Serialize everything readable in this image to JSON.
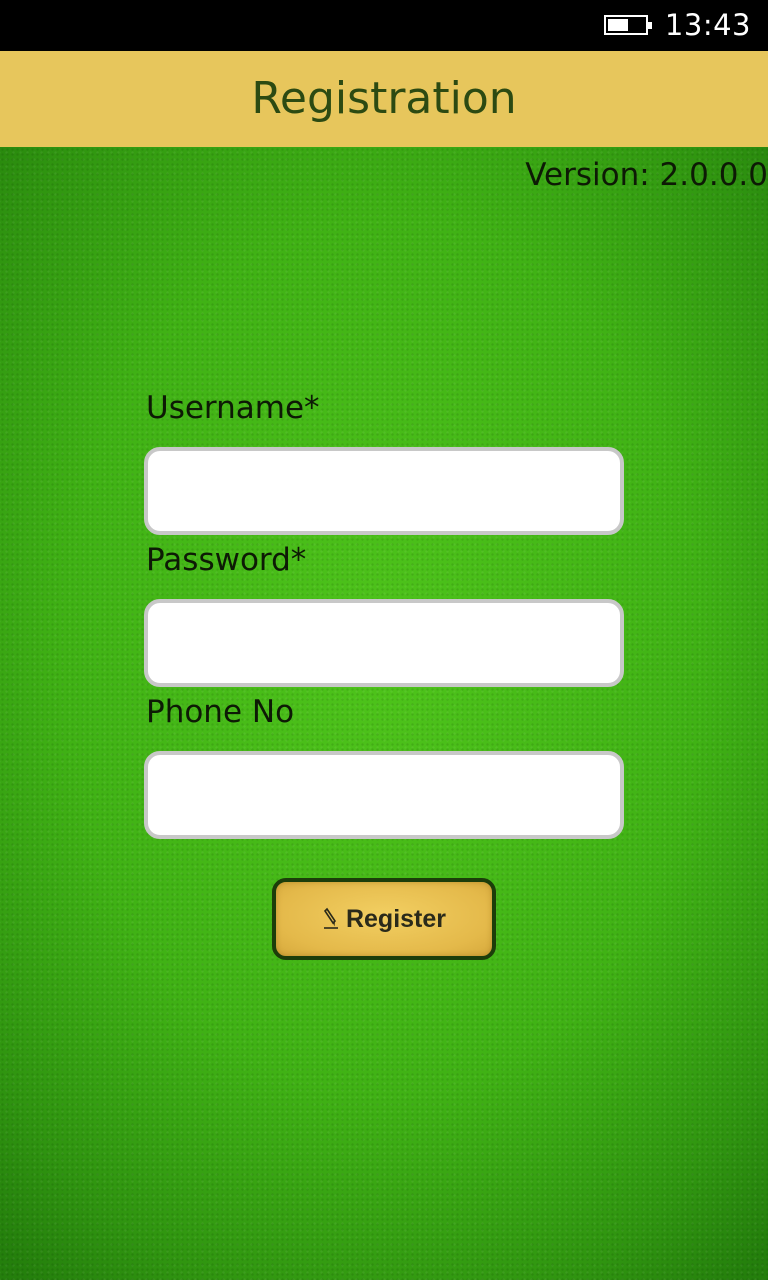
{
  "status_bar": {
    "battery_level": 0.55,
    "time": "13:43"
  },
  "header": {
    "title": "Registration"
  },
  "version_text": "Version: 2.0.0.0",
  "form": {
    "username": {
      "label": "Username*",
      "value": "",
      "placeholder": ""
    },
    "password": {
      "label": "Password*",
      "value": "",
      "placeholder": ""
    },
    "phone": {
      "label": "Phone No",
      "value": "",
      "placeholder": ""
    }
  },
  "register_button": {
    "icon": "pencil-icon",
    "label": "Register"
  },
  "colors": {
    "header_bg": "#e7c65c",
    "header_text": "#2c4a12",
    "background_green": "#40b215",
    "button_bg": "#e4b94a",
    "button_border": "#1c3d0a"
  }
}
